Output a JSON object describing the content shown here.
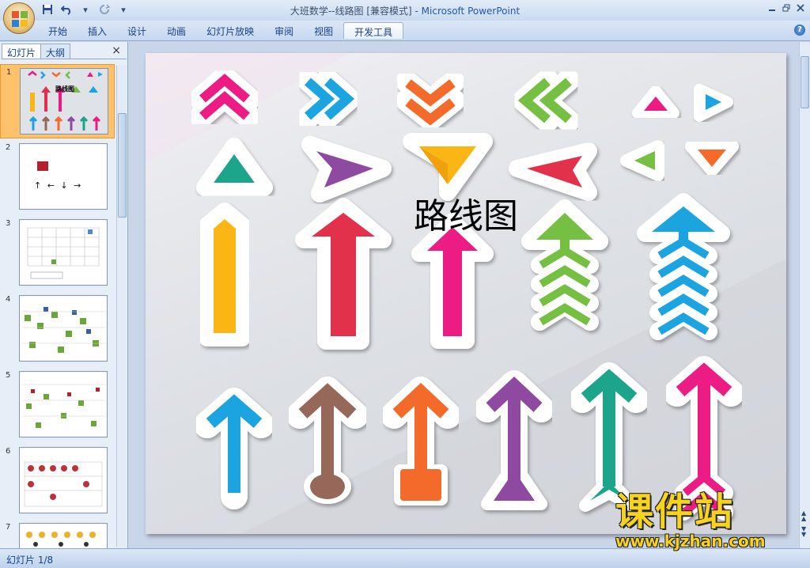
{
  "window": {
    "title": "大班数学--线路图 [兼容模式]",
    "separator": " - ",
    "app_name": "Microsoft PowerPoint"
  },
  "ribbon": {
    "tabs": [
      {
        "label": "开始"
      },
      {
        "label": "插入"
      },
      {
        "label": "设计"
      },
      {
        "label": "动画"
      },
      {
        "label": "幻灯片放映"
      },
      {
        "label": "审阅"
      },
      {
        "label": "视图"
      },
      {
        "label": "开发工具",
        "active": true
      }
    ],
    "help": "?"
  },
  "panel": {
    "tabs": [
      {
        "label": "幻灯片"
      },
      {
        "label": "大纲"
      }
    ],
    "close": "×",
    "thumbnails": [
      {
        "number": "1",
        "caption": "路线图",
        "selected": true
      },
      {
        "number": "2",
        "arrows": "↑ ← ↓ →"
      },
      {
        "number": "3"
      },
      {
        "number": "4"
      },
      {
        "number": "5"
      },
      {
        "number": "6"
      },
      {
        "number": "7"
      }
    ]
  },
  "slide": {
    "title": "路线图"
  },
  "watermark": {
    "name": "课件站",
    "url": "www.kjzhan.com"
  },
  "status": {
    "slide_counter": "幻灯片 1/8"
  },
  "colors": {
    "pink": "#ec1b84",
    "blue": "#1ba4e0",
    "orange": "#f36a2a",
    "green": "#74bf43",
    "teal": "#1aa58a",
    "purple": "#8e4aa0",
    "yellow": "#fbb614",
    "red": "#e2304c",
    "brown": "#96685a",
    "accent": "#ffc26a"
  }
}
